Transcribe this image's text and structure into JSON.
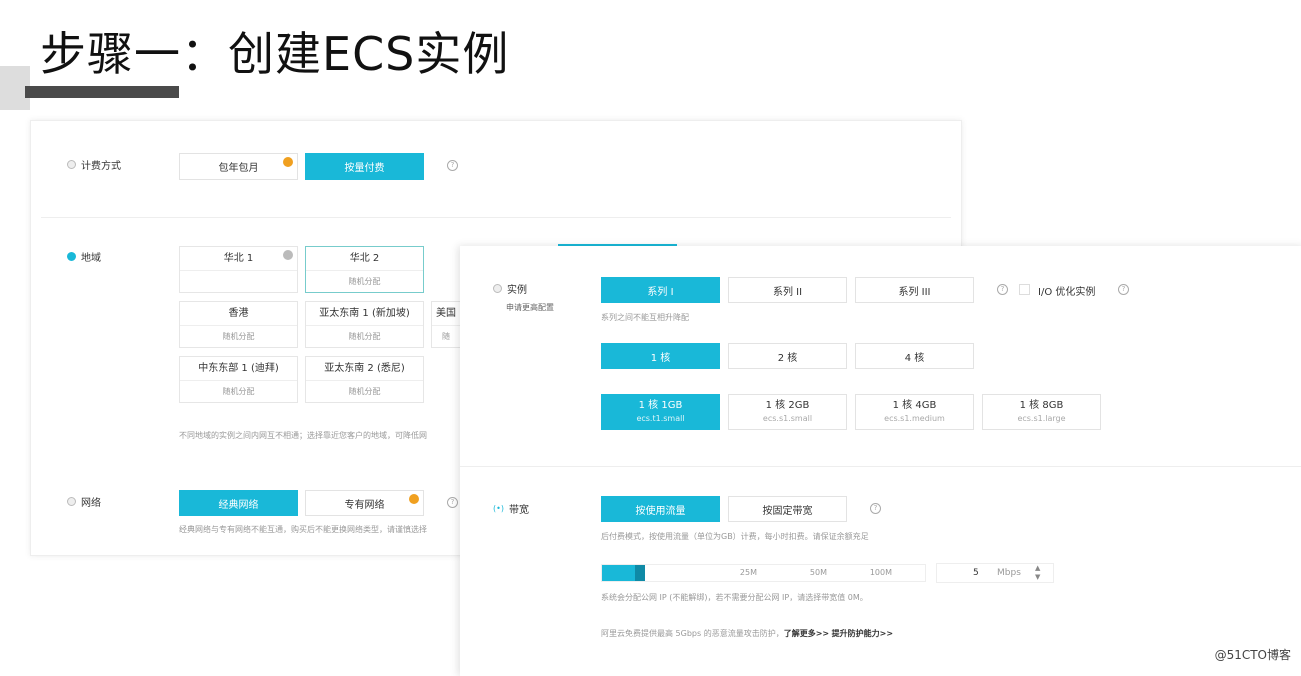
{
  "slide": {
    "title": "步骤一：创建ECS实例"
  },
  "billing": {
    "label": "计费方式",
    "options": [
      "包年包月",
      "按量付费"
    ],
    "selected": 1
  },
  "region": {
    "label": "地域",
    "items": [
      {
        "name": "华北 1",
        "zone": ""
      },
      {
        "name": "华北 2",
        "zone": "随机分配"
      },
      {
        "name": "香港",
        "zone": "随机分配"
      },
      {
        "name": "亚太东南 1 (新加坡)",
        "zone": "随机分配"
      },
      {
        "name": "美国",
        "zone": "随"
      },
      {
        "name": "中东东部 1 (迪拜)",
        "zone": "随机分配"
      },
      {
        "name": "亚太东南 2 (悉尼)",
        "zone": "随机分配"
      }
    ],
    "hint": "不同地域的实例之间内网互不相通；选择靠近您客户的地域，可降低网"
  },
  "network": {
    "label": "网络",
    "options": [
      "经典网络",
      "专有网络"
    ],
    "hint": "经典网络与专有网络不能互通，购买后不能更换网络类型，请谨慎选择"
  },
  "instance": {
    "label": "实例",
    "sublabel": "申请更高配置",
    "series": [
      "系列 I",
      "系列 II",
      "系列 III"
    ],
    "io_label": "I/O 优化实例",
    "series_hint": "系列之间不能互相升降配",
    "cores": [
      "1 核",
      "2 核",
      "4 核"
    ],
    "types": [
      {
        "spec": "1 核 1GB",
        "code": "ecs.t1.small"
      },
      {
        "spec": "1 核 2GB",
        "code": "ecs.s1.small"
      },
      {
        "spec": "1 核 4GB",
        "code": "ecs.s1.medium"
      },
      {
        "spec": "1 核 8GB",
        "code": "ecs.s1.large"
      }
    ]
  },
  "bandwidth": {
    "label": "带宽",
    "options": [
      "按使用流量",
      "按固定带宽"
    ],
    "hint": "后付费模式，按使用流量（单位为GB）计费，每小时扣费。请保证余额充足",
    "ticks": [
      "25M",
      "50M",
      "100M"
    ],
    "value": "5",
    "unit": "Mbps",
    "slider_percent": 5,
    "ip_hint": "系统会分配公网 IP (不能解绑)，若不需要分配公网 IP，请选择带宽值 0M。",
    "ddos_hint": "阿里云免费提供最高 5Gbps 的恶意流量攻击防护，",
    "learn_more": "了解更多>>",
    "upgrade": "提升防护能力>>"
  },
  "watermark": "@51CTO博客",
  "accent": "#19b8d8"
}
